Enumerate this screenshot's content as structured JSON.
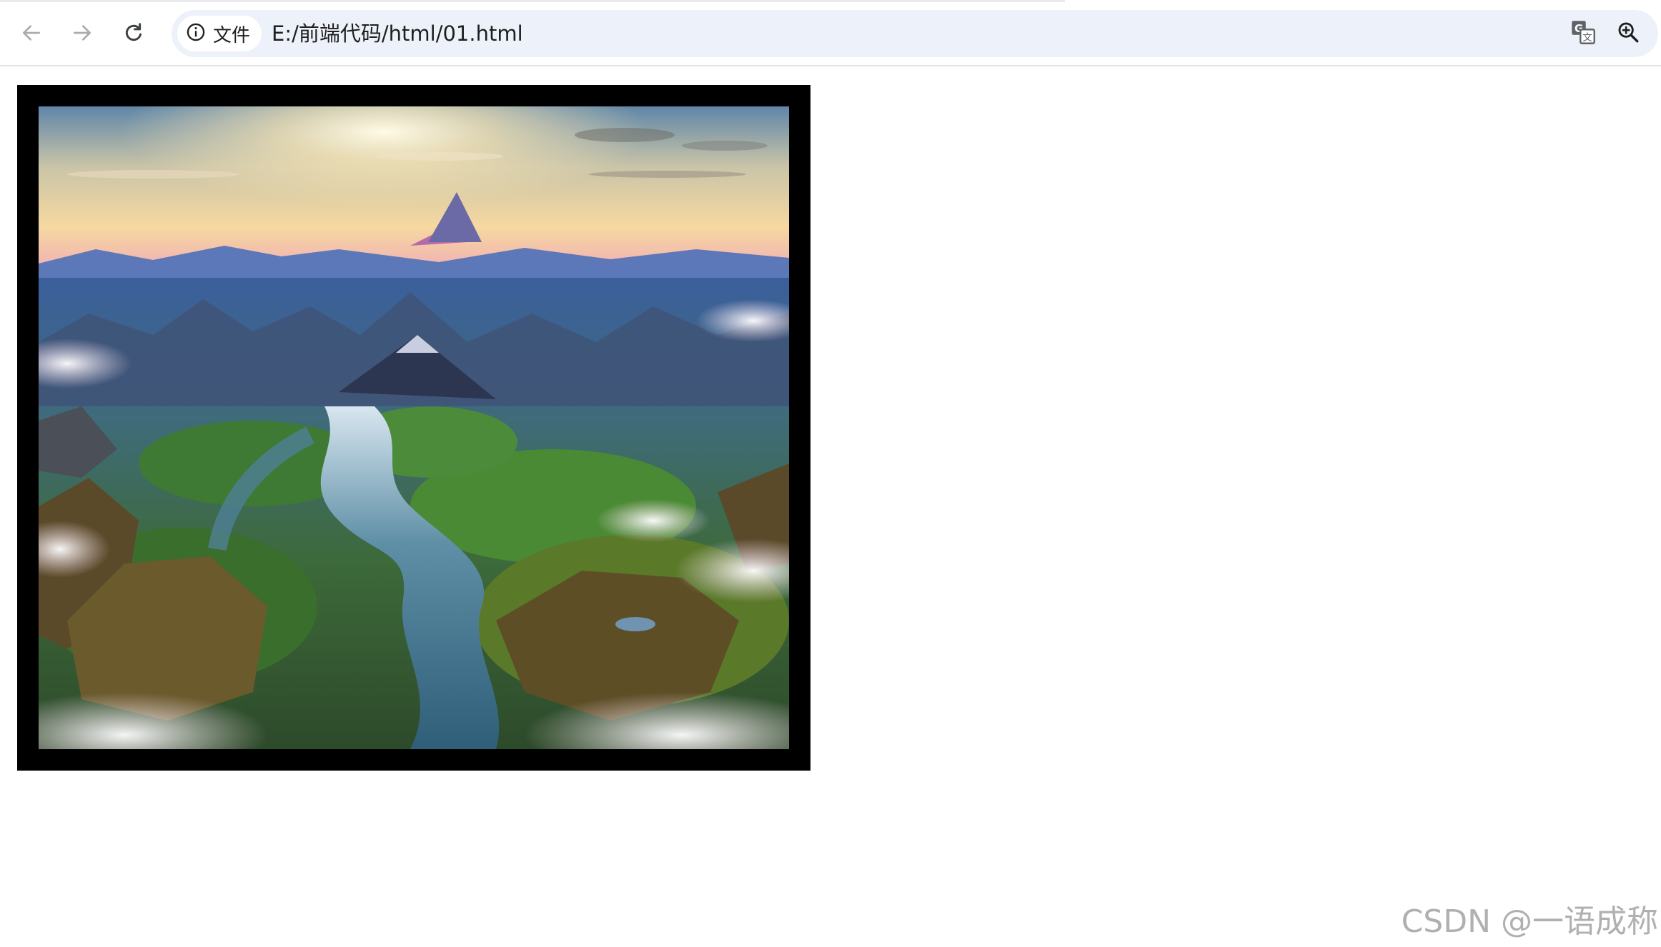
{
  "toolbar": {
    "back_icon": "arrow-left-icon",
    "forward_icon": "arrow-right-icon",
    "reload_icon": "reload-icon"
  },
  "address_bar": {
    "site_info_icon": "info-circle-icon",
    "site_info_label": "文件",
    "url": "E:/前端代码/html/01.html",
    "translate_icon": "translate-icon",
    "zoom_icon": "zoom-in-icon"
  },
  "page": {
    "image": {
      "icon": "fantasy-landscape-image",
      "frame_color": "#000000"
    }
  },
  "watermark": {
    "text": "CSDN @一语成称"
  },
  "colors": {
    "omnibox_bg": "#edf2fa",
    "chip_bg": "#ffffff",
    "text": "#1f1f1f"
  }
}
